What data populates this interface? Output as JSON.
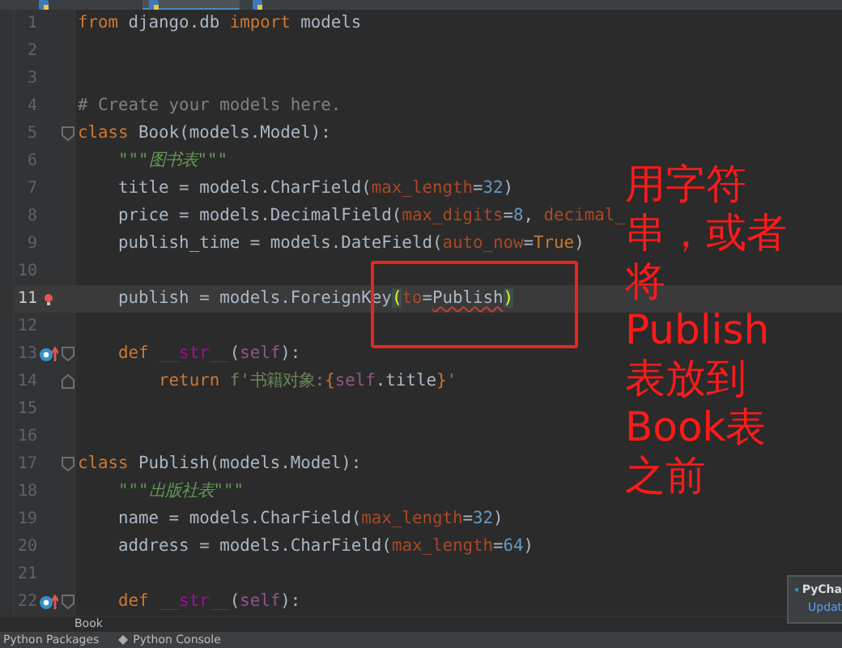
{
  "tabs": [
    {
      "selected": false
    },
    {
      "selected": true
    },
    {
      "selected": false
    }
  ],
  "lines": [
    {
      "number": "1",
      "current": false,
      "tokens": [
        {
          "kind": "kw",
          "text": "from "
        },
        {
          "kind": "plain",
          "text": "django.db "
        },
        {
          "kind": "kw",
          "text": "import "
        },
        {
          "kind": "plain",
          "text": "models"
        }
      ]
    },
    {
      "number": "2",
      "current": false
    },
    {
      "number": "3",
      "current": false
    },
    {
      "number": "4",
      "current": false,
      "tokens": [
        {
          "kind": "comment",
          "text": "# Create your models here."
        }
      ]
    },
    {
      "number": "5",
      "current": false,
      "markers": [
        {
          "kind": "fold"
        }
      ],
      "tokens": [
        {
          "kind": "kw",
          "text": "class "
        },
        {
          "kind": "plain",
          "text": "Book(models.Model):"
        }
      ]
    },
    {
      "number": "6",
      "current": false,
      "tokens": [
        {
          "kind": "doc",
          "text": "    \"\"\"图书表\"\"\""
        }
      ]
    },
    {
      "number": "7",
      "current": false,
      "tokens": [
        {
          "kind": "plain",
          "text": "    title = models.CharField("
        },
        {
          "kind": "param",
          "text": "max_length"
        },
        {
          "kind": "plain",
          "text": "="
        },
        {
          "kind": "num",
          "text": "32"
        },
        {
          "kind": "plain",
          "text": ")"
        }
      ]
    },
    {
      "number": "8",
      "current": false,
      "tokens": [
        {
          "kind": "plain",
          "text": "    price = models.DecimalField("
        },
        {
          "kind": "param",
          "text": "max_digits"
        },
        {
          "kind": "plain",
          "text": "="
        },
        {
          "kind": "num",
          "text": "8"
        },
        {
          "kind": "plain",
          "text": ", "
        },
        {
          "kind": "param",
          "text": "decimal_"
        }
      ]
    },
    {
      "number": "9",
      "current": false,
      "tokens": [
        {
          "kind": "plain",
          "text": "    publish_time = models.DateField("
        },
        {
          "kind": "param",
          "text": "auto_now"
        },
        {
          "kind": "plain",
          "text": "="
        },
        {
          "kind": "kw",
          "text": "True"
        },
        {
          "kind": "plain",
          "text": ")"
        }
      ]
    },
    {
      "number": "10",
      "current": false
    },
    {
      "number": "11",
      "current": true,
      "markers": [
        {
          "kind": "error"
        }
      ],
      "tokens": [
        {
          "kind": "plain",
          "text": "    publish = models.ForeignKey"
        },
        {
          "kind": "match",
          "text": "("
        },
        {
          "kind": "param",
          "text": "to"
        },
        {
          "kind": "plain",
          "text": "="
        },
        {
          "kind": "error",
          "text": "Publish"
        },
        {
          "kind": "match",
          "text": ")"
        }
      ]
    },
    {
      "number": "12",
      "current": false
    },
    {
      "number": "13",
      "current": false,
      "markers": [
        {
          "kind": "override"
        },
        {
          "kind": "fold"
        }
      ],
      "tokens": [
        {
          "kind": "kw",
          "text": "    def "
        },
        {
          "kind": "magic",
          "text": "__str__"
        },
        {
          "kind": "plain",
          "text": "("
        },
        {
          "kind": "self",
          "text": "self"
        },
        {
          "kind": "plain",
          "text": "):"
        }
      ]
    },
    {
      "number": "14",
      "current": false,
      "markers": [
        {
          "kind": "fold_end"
        }
      ],
      "tokens": [
        {
          "kind": "kw",
          "text": "        return "
        },
        {
          "kind": "str",
          "text": "f'书籍对象:"
        },
        {
          "kind": "kw",
          "text": "{"
        },
        {
          "kind": "self",
          "text": "self"
        },
        {
          "kind": "plain",
          "text": ".title"
        },
        {
          "kind": "kw",
          "text": "}"
        },
        {
          "kind": "str",
          "text": "'"
        }
      ]
    },
    {
      "number": "15",
      "current": false
    },
    {
      "number": "16",
      "current": false
    },
    {
      "number": "17",
      "current": false,
      "markers": [
        {
          "kind": "fold"
        }
      ],
      "tokens": [
        {
          "kind": "kw",
          "text": "class "
        },
        {
          "kind": "plain",
          "text": "Publish(models.Model):"
        }
      ]
    },
    {
      "number": "18",
      "current": false,
      "tokens": [
        {
          "kind": "doc",
          "text": "    \"\"\"出版社表\"\"\""
        }
      ]
    },
    {
      "number": "19",
      "current": false,
      "tokens": [
        {
          "kind": "plain",
          "text": "    name = models.CharField("
        },
        {
          "kind": "param",
          "text": "max_length"
        },
        {
          "kind": "plain",
          "text": "="
        },
        {
          "kind": "num",
          "text": "32"
        },
        {
          "kind": "plain",
          "text": ")"
        }
      ]
    },
    {
      "number": "20",
      "current": false,
      "tokens": [
        {
          "kind": "plain",
          "text": "    address = models.CharField("
        },
        {
          "kind": "param",
          "text": "max_length"
        },
        {
          "kind": "plain",
          "text": "="
        },
        {
          "kind": "num",
          "text": "64"
        },
        {
          "kind": "plain",
          "text": ")"
        }
      ]
    },
    {
      "number": "21",
      "current": false
    },
    {
      "number": "22",
      "current": false,
      "markers": [
        {
          "kind": "override"
        },
        {
          "kind": "fold"
        }
      ],
      "tokens": [
        {
          "kind": "kw",
          "text": "    def "
        },
        {
          "kind": "magic",
          "text": "__str__"
        },
        {
          "kind": "plain",
          "text": "("
        },
        {
          "kind": "self",
          "text": "self"
        },
        {
          "kind": "plain",
          "text": "):"
        }
      ]
    }
  ],
  "annotation": {
    "lines": [
      "用字符",
      "串，或者",
      "将",
      "Publish",
      "表放到",
      "Book表",
      "之前"
    ]
  },
  "breadcrumb": "Book",
  "notification": {
    "title": "PyCha",
    "link": "Updat"
  },
  "status_bar": [
    "Python Packages",
    "Python Console"
  ]
}
